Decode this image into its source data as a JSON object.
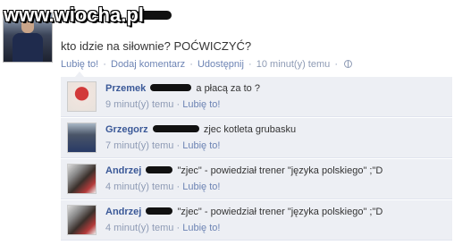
{
  "watermark": {
    "text": "www.wiocha.pl"
  },
  "post": {
    "text": "kto idzie na siłownie? POĆWICZYĆ?",
    "actions": {
      "like": "Lubię to!",
      "comment": "Dodaj komentarz",
      "share": "Udostępnij",
      "time": "10 minut(y) temu",
      "sep": "·"
    }
  },
  "comments": [
    {
      "name": "Przemek",
      "text": "a płacą za to ?",
      "time": "9 minut(y) temu",
      "like": "Lubię to!",
      "avatar": "avatar-przemek",
      "redact_w": 46
    },
    {
      "name": "Grzegorz",
      "text": "zjec kotleta grubasku",
      "time": "7 minut(y) temu",
      "like": "Lubię to!",
      "avatar": "avatar-grzegorz",
      "redact_w": 52
    },
    {
      "name": "Andrzej",
      "text": "\"zjec\" - powiedział trener \"języka polskiego\" ;\"D",
      "time": "4 minut(y) temu",
      "like": "Lubię to!",
      "avatar": "avatar-andrzej",
      "redact_w": 30
    },
    {
      "name": "Andrzej",
      "text": "\"zjec\" - powiedział trener \"języka polskiego\" ;\"D",
      "time": "4 minut(y) temu",
      "like": "Lubię to!",
      "avatar": "avatar-andrzej",
      "redact_w": 30
    }
  ],
  "colors": {
    "link": "#3b5998",
    "meta": "#8e9bb5",
    "comment_bg": "#edeff4"
  }
}
